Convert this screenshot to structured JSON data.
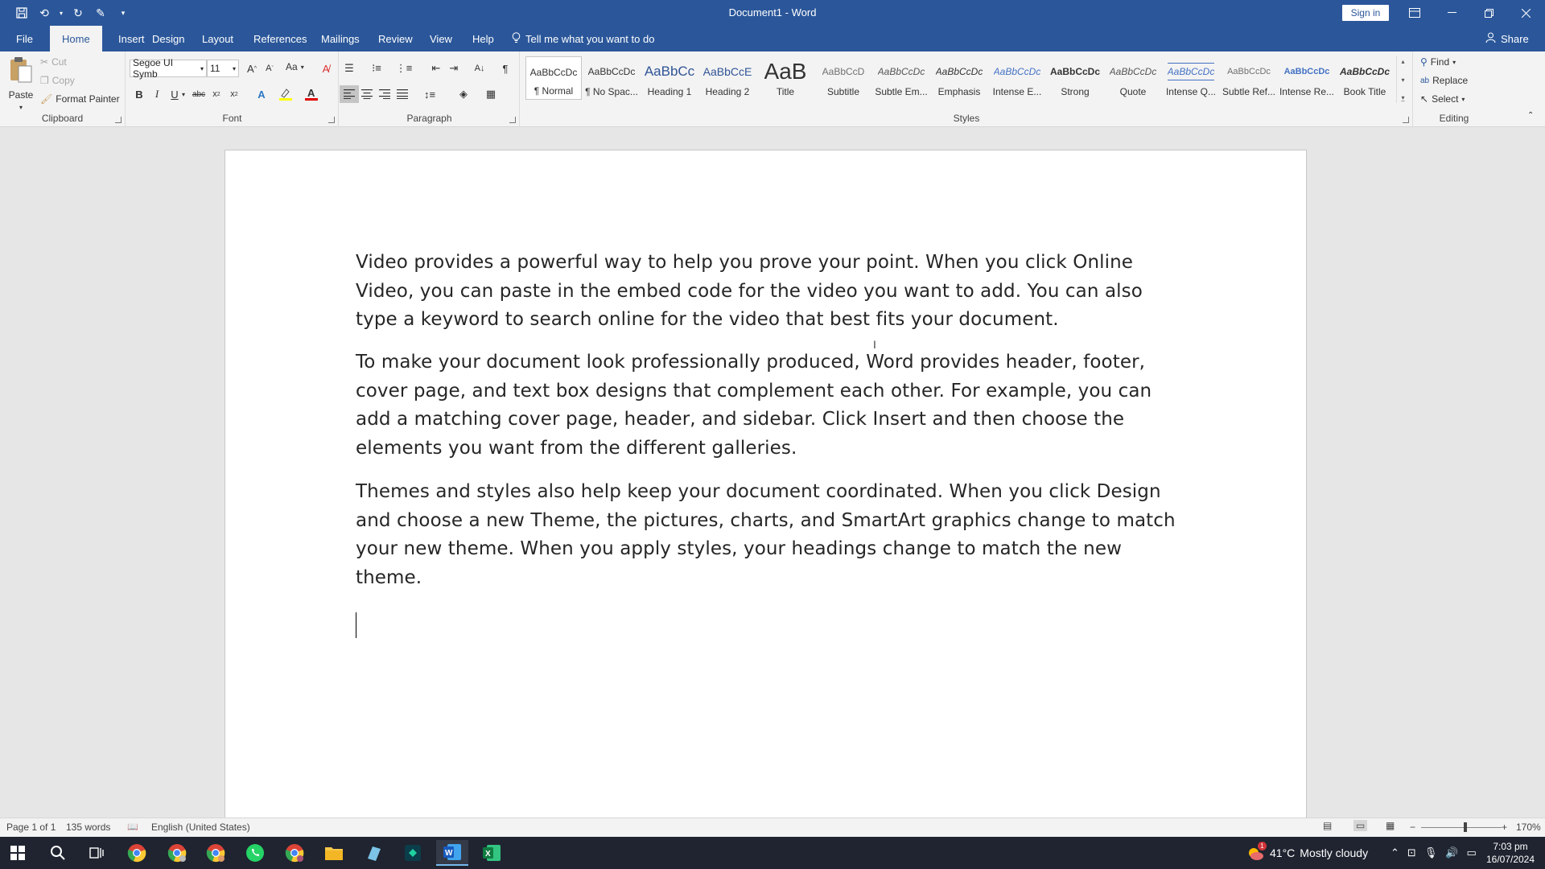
{
  "window": {
    "title": "Document1  -  Word",
    "sign_in": "Sign in"
  },
  "menu": {
    "tabs": [
      "File",
      "Home",
      "Insert",
      "Design",
      "Layout",
      "References",
      "Mailings",
      "Review",
      "View",
      "Help"
    ],
    "active": "Home",
    "tell_me": "Tell me what you want to do",
    "share": "Share"
  },
  "ribbon": {
    "clipboard": {
      "label": "Clipboard",
      "paste": "Paste",
      "cut": "Cut",
      "copy": "Copy",
      "format_painter": "Format Painter"
    },
    "font": {
      "label": "Font",
      "name": "Segoe UI Symb",
      "size": "11",
      "case": "Aa"
    },
    "paragraph": {
      "label": "Paragraph"
    },
    "styles": {
      "label": "Styles",
      "items": [
        {
          "sample": "AaBbCcDc",
          "name": "¶ Normal"
        },
        {
          "sample": "AaBbCcDc",
          "name": "¶ No Spac..."
        },
        {
          "sample": "AaBbCc",
          "name": "Heading 1"
        },
        {
          "sample": "AaBbCcE",
          "name": "Heading 2"
        },
        {
          "sample": "AaB",
          "name": "Title"
        },
        {
          "sample": "AaBbCcD",
          "name": "Subtitle"
        },
        {
          "sample": "AaBbCcDc",
          "name": "Subtle Em..."
        },
        {
          "sample": "AaBbCcDc",
          "name": "Emphasis"
        },
        {
          "sample": "AaBbCcDc",
          "name": "Intense E..."
        },
        {
          "sample": "AaBbCcDc",
          "name": "Strong"
        },
        {
          "sample": "AaBbCcDc",
          "name": "Quote"
        },
        {
          "sample": "AaBbCcDc",
          "name": "Intense Q..."
        },
        {
          "sample": "AaBbCcDc",
          "name": "Subtle Ref..."
        },
        {
          "sample": "AaBbCcDc",
          "name": "Intense Re..."
        },
        {
          "sample": "AaBbCcDc",
          "name": "Book Title"
        }
      ]
    },
    "editing": {
      "label": "Editing",
      "find": "Find",
      "replace": "Replace",
      "select": "Select"
    }
  },
  "document": {
    "paragraphs": [
      "Video provides a powerful way to help you prove your point. When you click Online Video, you can paste in the embed code for the video you want to add. You can also type a keyword to search online for the video that best fits your document.",
      "To make your document look professionally produced, Word provides header, footer, cover page, and text box designs that complement each other. For example, you can add a matching cover page, header, and sidebar. Click Insert and then choose the elements you want from the different galleries.",
      "Themes and styles also help keep your document coordinated. When you click Design and choose a new Theme, the pictures, charts, and SmartArt graphics change to match your new theme. When you apply styles, your headings change to match the new theme."
    ]
  },
  "status": {
    "page": "Page 1 of 1",
    "words": "135 words",
    "language": "English (United States)",
    "zoom": "170%"
  },
  "taskbar": {
    "weather_temp": "41°C",
    "weather_desc": "Mostly cloudy",
    "time": "7:03 pm",
    "date": "16/07/2024",
    "notification_count": "1"
  },
  "colors": {
    "word_blue": "#2b579a",
    "font_color_bar": "#e00000",
    "highlight_bar": "#ffff00"
  }
}
